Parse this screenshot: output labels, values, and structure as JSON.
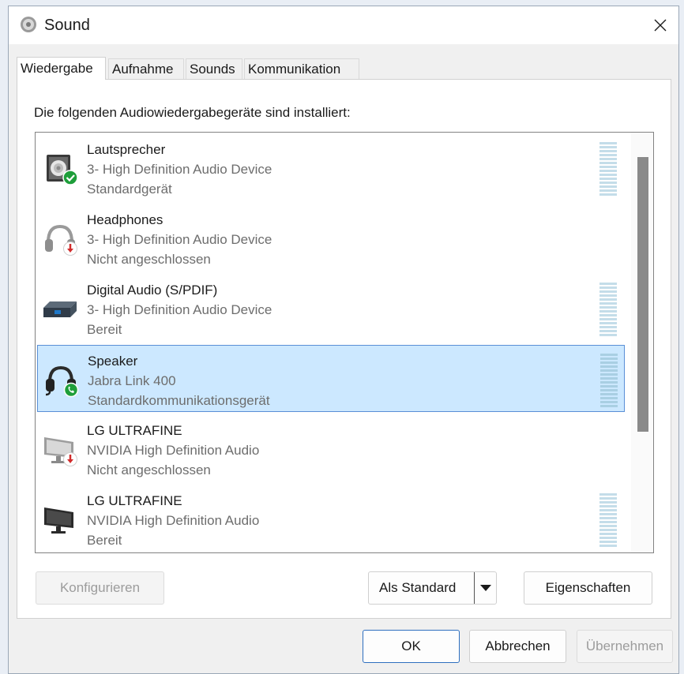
{
  "window": {
    "title": "Sound"
  },
  "tabs": [
    {
      "label": "Wiedergabe",
      "active": true
    },
    {
      "label": "Aufnahme",
      "active": false
    },
    {
      "label": "Sounds",
      "active": false
    },
    {
      "label": "Kommunikation",
      "active": false
    }
  ],
  "intro": "Die folgenden Audiowiedergabegeräte sind installiert:",
  "devices": [
    {
      "name": "Lautsprecher",
      "description": "3- High Definition Audio Device",
      "status": "Standardgerät",
      "icon": "speaker-icon",
      "badge": "check-badge-icon"
    },
    {
      "name": "Headphones",
      "description": "3- High Definition Audio Device",
      "status": "Nicht angeschlossen",
      "icon": "headphones-icon",
      "badge": "unplugged-badge-icon"
    },
    {
      "name": "Digital Audio (S/PDIF)",
      "description": "3- High Definition Audio Device",
      "status": "Bereit",
      "icon": "digital-audio-icon",
      "badge": ""
    },
    {
      "name": "Speaker",
      "description": "Jabra Link 400",
      "status": "Standardkommunikationsgerät",
      "icon": "headset-icon",
      "badge": "phone-badge-icon",
      "selected": true
    },
    {
      "name": "LG ULTRAFINE",
      "description": "NVIDIA High Definition Audio",
      "status": "Nicht angeschlossen",
      "icon": "monitor-icon",
      "badge": "unplugged-badge-icon"
    },
    {
      "name": "LG ULTRAFINE",
      "description": "NVIDIA High Definition Audio",
      "status": "Bereit",
      "icon": "monitor-icon",
      "badge": ""
    }
  ],
  "buttons": {
    "configure": "Konfigurieren",
    "set_default": "Als Standard",
    "properties": "Eigenschaften",
    "ok": "OK",
    "cancel": "Abbrechen",
    "apply": "Übernehmen"
  },
  "colors": {
    "selection": "#cce8ff",
    "meter": "#c4dde9",
    "badge_green": "#1e9e3a",
    "badge_red": "#d12b2b"
  }
}
